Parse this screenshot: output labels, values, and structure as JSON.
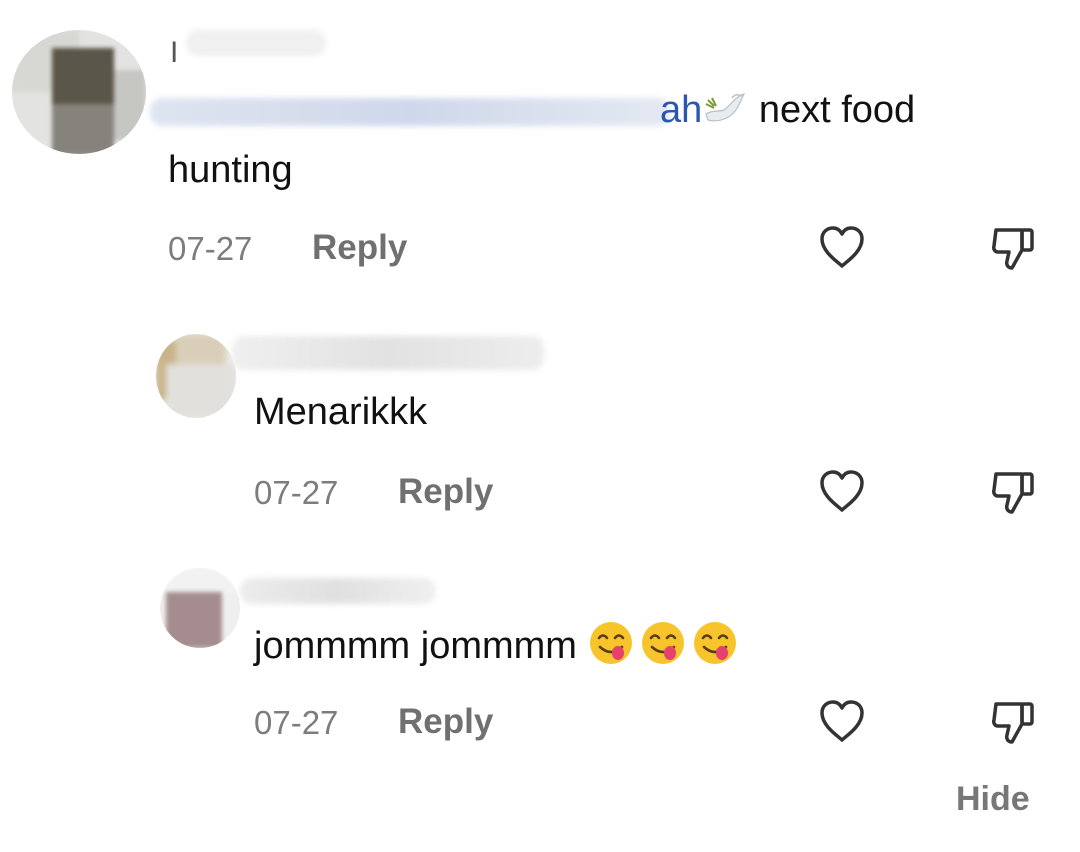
{
  "comments": [
    {
      "username": "I",
      "mention_visible": "ah",
      "text_line1": " next food",
      "text_line2": "hunting",
      "date": "07-27",
      "reply_label": "Reply"
    },
    {
      "username": "",
      "text": "Menarikkk",
      "date": "07-27",
      "reply_label": "Reply"
    },
    {
      "username": "",
      "text": "jommmm jommmm",
      "emoji": [
        "face-savoring-food-emoji",
        "face-savoring-food-emoji",
        "face-savoring-food-emoji"
      ],
      "date": "07-27",
      "reply_label": "Reply"
    }
  ],
  "icons": {
    "like": "heart-outline-icon",
    "dislike": "thumbs-down-outline-icon",
    "dove": "dove-emoji"
  },
  "footer": {
    "hide_label": "Hide"
  },
  "colors": {
    "mention": "#2b57b0",
    "meta": "#7d7d7d",
    "text": "#111111"
  }
}
